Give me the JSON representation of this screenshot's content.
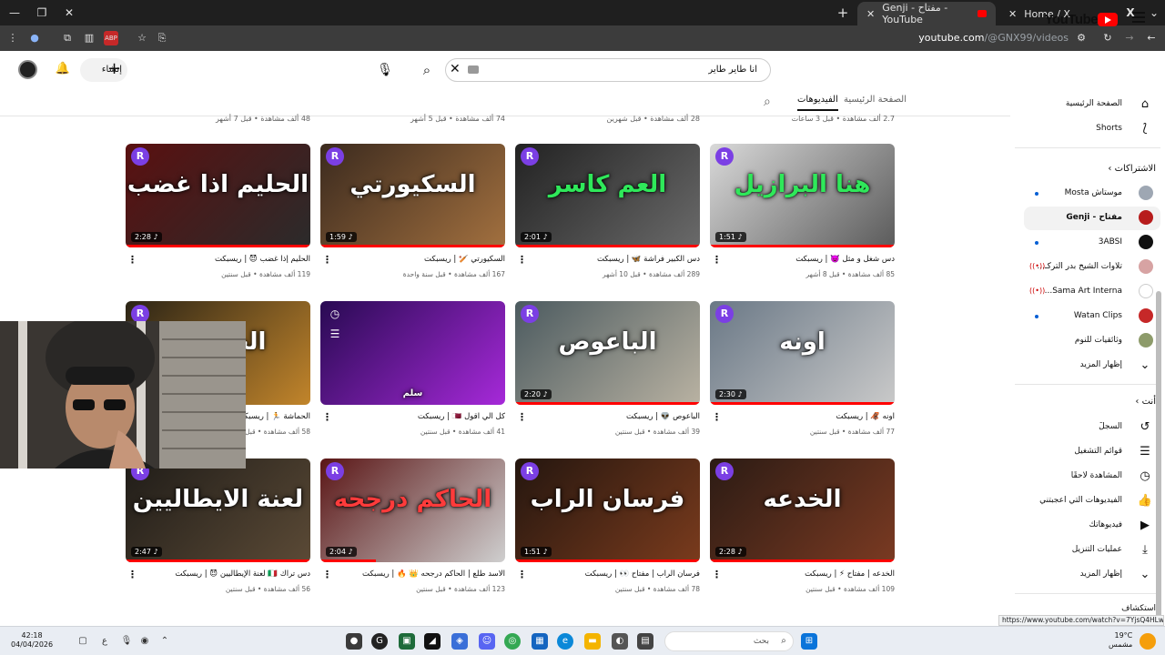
{
  "browser": {
    "tabs": [
      {
        "title": "Genji - مفتاح - YouTube"
      },
      {
        "title": "Home / X"
      }
    ],
    "url_host": "youtube.com",
    "url_path": "/@GNX99/videos"
  },
  "header": {
    "logo": "YouTube",
    "search_value": "انا طاير طاير",
    "create_label": "إنشاء"
  },
  "channel_tabs": [
    "الصفحة الرئيسية",
    "الفيديوهات"
  ],
  "prev_row_meta": [
    "2.7 ألف مشاهدة • قبل 3 ساعات",
    "28 ألف مشاهدة • قبل شهرين",
    "74 ألف مشاهدة • قبل 5 أشهر",
    "48 ألف مشاهدة • قبل 7 أشهر"
  ],
  "videos": [
    {
      "title": "دس شغل و مثل 👿 | ريسبكت",
      "meta": "85 ألف مشاهدة • قبل 8 أشهر",
      "duration": "1:51",
      "thumb_text": "هنا البرازيل",
      "progress": 1.0
    },
    {
      "title": "دس الكبير فراشة 🦋 | ريسبكت",
      "meta": "289 ألف مشاهدة • قبل 10 أشهر",
      "duration": "2:01",
      "thumb_text": "العم كاسر",
      "progress": 1.0
    },
    {
      "title": "السكيورتي 🏏 | ريسبكت",
      "meta": "167 ألف مشاهدة • قبل سنة واحدة",
      "duration": "1:59",
      "thumb_text": "السكيورتي",
      "progress": 1.0
    },
    {
      "title": "الحليم إذا غضب 😈 | ريسبكت",
      "meta": "119 ألف مشاهدة • قبل سنتين",
      "duration": "2:28",
      "thumb_text": "الحليم اذا غضب",
      "progress": 1.0
    },
    {
      "title": "اونه 🦧 | ريسبكت",
      "meta": "77 ألف مشاهدة • قبل سنتين",
      "duration": "2:30",
      "thumb_text": "اونه",
      "progress": 1.0
    },
    {
      "title": "الباعوص 👽 | ريسبكت",
      "meta": "39 ألف مشاهدة • قبل سنتين",
      "duration": "2:20",
      "thumb_text": "الباعوص",
      "progress": 1.0
    },
    {
      "title": "كل الي اقول 🇶🇦 | ريسبكت",
      "meta": "41 ألف مشاهدة • قبل سنتين",
      "duration": "",
      "thumb_text": "سلم",
      "progress": 0
    },
    {
      "title": "الحماشة 🏃 | ريسبكت",
      "meta": "58 ألف مشاهدة • قبل سنتين",
      "duration": "",
      "thumb_text": "الحماشة",
      "progress": 0
    },
    {
      "title": "الخدعه | مفتاح ⚡ | ريسبكت",
      "meta": "109 ألف مشاهدة • قبل سنتين",
      "duration": "2:28",
      "thumb_text": "الخدعه",
      "progress": 1.0
    },
    {
      "title": "فرسان الراب | مفتاح 👀 | ريسبكت",
      "meta": "78 ألف مشاهدة • قبل سنتين",
      "duration": "1:51",
      "thumb_text": "فرسان الراب",
      "progress": 1.0
    },
    {
      "title": "الاسد طلع | الحاكم درجحه 👑 🔥 | ريسبكت",
      "meta": "123 ألف مشاهدة • قبل سنتين",
      "duration": "2:04",
      "thumb_text": "الحاكم درجحه",
      "progress": 0.3
    },
    {
      "title": "دس تراك 🇮🇹 لعنة الإيطاليين 😈 | ريسبكت",
      "meta": "56 ألف مشاهدة • قبل سنتين",
      "duration": "2:47",
      "thumb_text": "لعنة الايطاليين",
      "progress": 1.0
    }
  ],
  "sidebar": {
    "home": "الصفحة الرئيسية",
    "shorts": "Shorts",
    "subs_head": "الاشتراكات",
    "subs": [
      "موستاش Mosta",
      "مفتاح - Genji",
      "3ABSI",
      "تلاوات الشيخ بدر التركـ...",
      "Sama Art Interna...",
      "Watan Clips",
      "وثائقيات للنوم",
      "إظهار المزيد"
    ],
    "you_head": "أنت",
    "you": [
      "السجلّ",
      "قوائم التشغيل",
      "المشاهدة لاحقًا",
      "الفيديوهات التي أعجبتني",
      "فيديوهاتك",
      "عمليات التنزيل",
      "إظهار المزيد"
    ],
    "bottom_head": "استكشاف"
  },
  "status_url": "https://www.youtube.com/watch?v=7YjsQ4HLwCs",
  "taskbar": {
    "time": "42:18",
    "date": "04/04/2026",
    "lang": "ع",
    "search_placeholder": "بحث",
    "temp": "19°C",
    "weather": "مشمس"
  }
}
